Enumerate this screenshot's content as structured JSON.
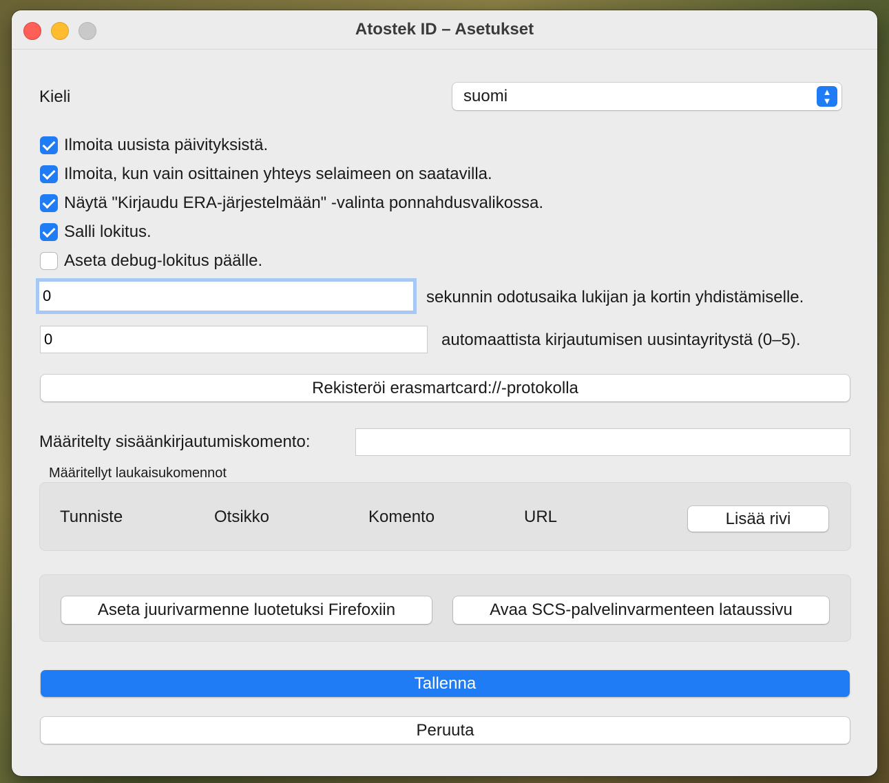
{
  "window": {
    "title": "Atostek ID – Asetukset"
  },
  "language": {
    "label": "Kieli",
    "selected": "suomi"
  },
  "checkboxes": [
    {
      "label": "Ilmoita uusista päivityksistä.",
      "checked": true
    },
    {
      "label": "Ilmoita, kun vain osittainen yhteys selaimeen on saatavilla.",
      "checked": true
    },
    {
      "label": "Näytä \"Kirjaudu ERA-järjestelmään\" -valinta ponnahdusvalikossa.",
      "checked": true
    },
    {
      "label": "Salli lokitus.",
      "checked": true
    },
    {
      "label": "Aseta debug-lokitus päälle.",
      "checked": false
    }
  ],
  "timeout": {
    "value": "0",
    "label": "sekunnin odotusaika lukijan ja kortin yhdistämiselle."
  },
  "retries": {
    "value": "0",
    "label": "automaattista kirjautumisen uusintayritystä (0–5)."
  },
  "register_protocol_label": "Rekisteröi erasmartcard://-protokolla",
  "login_command": {
    "label": "Määritelty sisäänkirjautumiskomento:",
    "value": ""
  },
  "launch_commands": {
    "title": "Määritellyt laukaisukomennot",
    "columns": [
      "Tunniste",
      "Otsikko",
      "Komento",
      "URL"
    ],
    "add_row_label": "Lisää rivi"
  },
  "certificates": {
    "firefox_label": "Aseta juurivarmenne luotetuksi Firefoxiin",
    "scs_label": "Avaa SCS-palvelinvarmenteen lataussivu"
  },
  "save_label": "Tallenna",
  "cancel_label": "Peruuta",
  "colors": {
    "accent": "#1f7cf5",
    "window_bg": "#ececec"
  }
}
